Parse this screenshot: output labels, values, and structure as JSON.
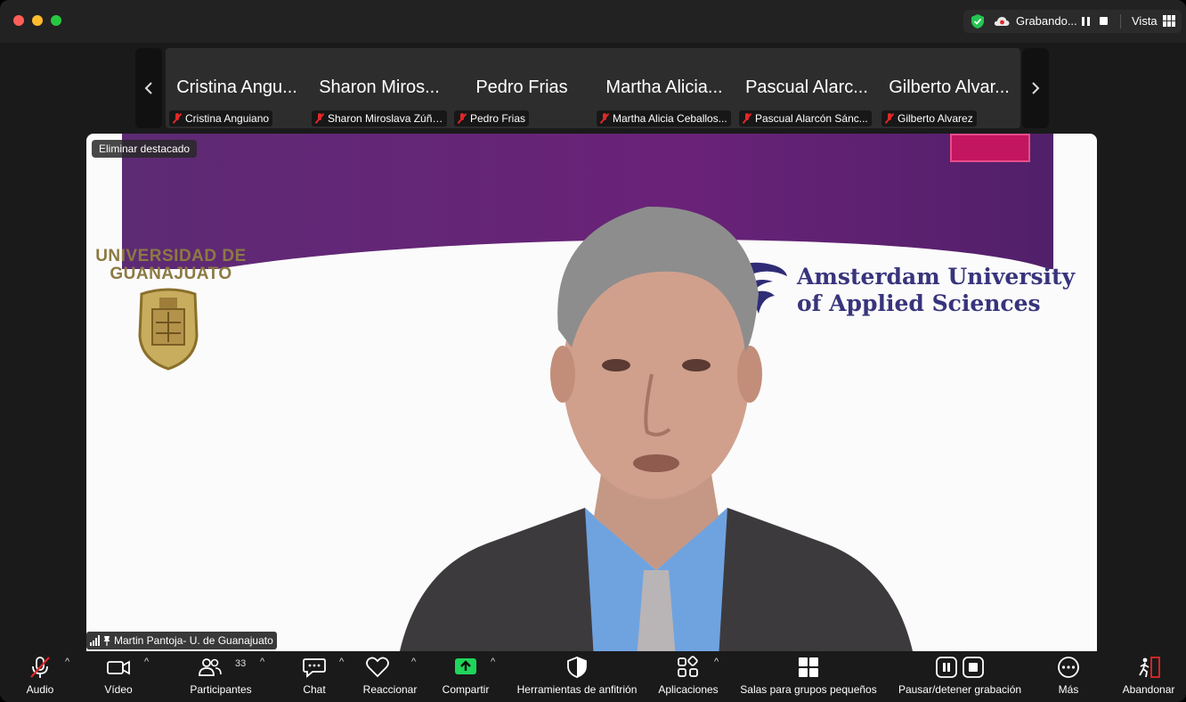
{
  "titlebar": {
    "recording_label": "Grabando...",
    "view_label": "Vista"
  },
  "gallery": {
    "tiles": [
      {
        "big": "Cristina Angu...",
        "small": "Cristina Anguiano"
      },
      {
        "big": "Sharon Miros...",
        "small": "Sharon Miroslava Zúñi..."
      },
      {
        "big": "Pedro Frias",
        "small": "Pedro Frias"
      },
      {
        "big": "Martha Alicia...",
        "small": "Martha Alicia Ceballos..."
      },
      {
        "big": "Pascual Alarc...",
        "small": "Pascual Alarcón Sánc..."
      },
      {
        "big": "Gilberto Alvar...",
        "small": "Gilberto Alvarez"
      }
    ]
  },
  "main_video": {
    "unpin_label": "Eliminar destacado",
    "speaker_name": "Martin Pantoja- U. de Guanajuato",
    "background": {
      "ug_text": "UNIVERSIDAD DE\nGUANAJUATO",
      "ams_line1": "Amsterdam University",
      "ams_line2": "of Applied Sciences"
    }
  },
  "toolbar": {
    "audio": "Audio",
    "video": "Vídeo",
    "participants": "Participantes",
    "participants_count": "33",
    "chat": "Chat",
    "react": "Reaccionar",
    "share": "Compartir",
    "host_tools": "Herramientas de anfitrión",
    "apps": "Aplicaciones",
    "breakout": "Salas para grupos pequeños",
    "pause_recording": "Pausar/detener grabación",
    "more": "Más",
    "leave": "Abandonar"
  },
  "colors": {
    "share_green": "#1fd55a",
    "leave_red": "#e02828",
    "banner_purple": "#5d2a74",
    "ams_blue": "#38347c"
  }
}
